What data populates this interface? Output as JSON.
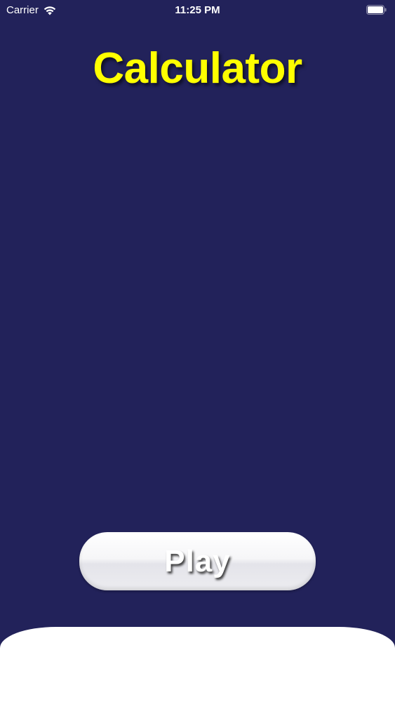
{
  "status_bar": {
    "carrier": "Carrier",
    "time": "11:25 PM",
    "wifi_icon": "wifi-icon",
    "battery_icon": "battery-icon"
  },
  "title": "Calculator",
  "play_button": {
    "label": "Play"
  },
  "colors": {
    "background": "#22225a",
    "title": "#ffff00",
    "button": "#f2f2f5",
    "button_text": "#ffffff",
    "bottom_panel": "#ffffff"
  }
}
